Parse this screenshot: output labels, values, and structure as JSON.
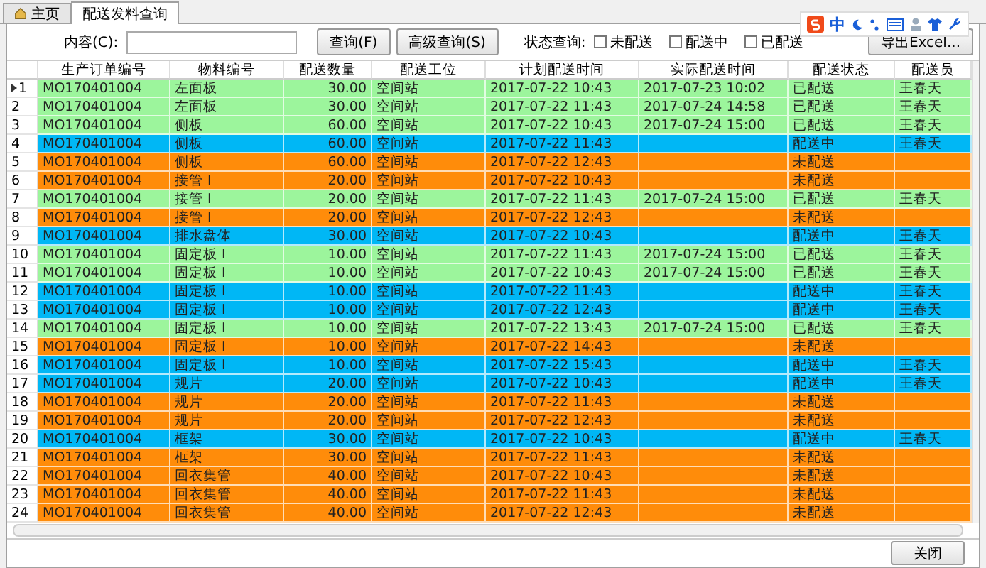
{
  "tabs": [
    {
      "label": "主页",
      "kind": "home",
      "selected": false
    },
    {
      "label": "配送发料查询",
      "kind": "plain",
      "selected": true
    }
  ],
  "ime_bar": {
    "label": "中"
  },
  "filter": {
    "content_label": "内容(C):",
    "query_button": "查询(F)",
    "advanced_button": "高级查询(S)",
    "status_label": "状态查询:",
    "statuses": [
      {
        "label": "未配送",
        "checked": false
      },
      {
        "label": "配送中",
        "checked": false
      },
      {
        "label": "已配送",
        "checked": false
      }
    ],
    "export_button": "导出Excel..."
  },
  "table": {
    "columns": [
      "生产订单编号",
      "物料编号",
      "配送数量",
      "配送工位",
      "计划配送时间",
      "实际配送时间",
      "配送状态",
      "配送员"
    ],
    "rows": [
      {
        "num": "1",
        "selected": true,
        "color": "#9cf59c",
        "cells": [
          "MO170401004",
          "左面板",
          "30.00",
          "空间站",
          "2017-07-22 10:43",
          "2017-07-23 10:02",
          "已配送",
          "王春天"
        ]
      },
      {
        "num": "2",
        "selected": false,
        "color": "#9cf59c",
        "cells": [
          "MO170401004",
          "左面板",
          "30.00",
          "空间站",
          "2017-07-22 11:43",
          "2017-07-24 14:58",
          "已配送",
          "王春天"
        ]
      },
      {
        "num": "3",
        "selected": false,
        "color": "#9cf59c",
        "cells": [
          "MO170401004",
          "侧板",
          "60.00",
          "空间站",
          "2017-07-22 10:43",
          "2017-07-24 15:00",
          "已配送",
          "王春天"
        ]
      },
      {
        "num": "4",
        "selected": false,
        "color": "#00b7f5",
        "cells": [
          "MO170401004",
          "侧板",
          "60.00",
          "空间站",
          "2017-07-22 11:43",
          "",
          "配送中",
          "王春天"
        ]
      },
      {
        "num": "5",
        "selected": false,
        "color": "#ff8c0a",
        "cells": [
          "MO170401004",
          "侧板",
          "60.00",
          "空间站",
          "2017-07-22 12:43",
          "",
          "未配送",
          ""
        ]
      },
      {
        "num": "6",
        "selected": false,
        "color": "#ff8c0a",
        "cells": [
          "MO170401004",
          "接管 I",
          "20.00",
          "空间站",
          "2017-07-22 10:43",
          "",
          "未配送",
          ""
        ]
      },
      {
        "num": "7",
        "selected": false,
        "color": "#9cf59c",
        "cells": [
          "MO170401004",
          "接管 I",
          "20.00",
          "空间站",
          "2017-07-22 11:43",
          "2017-07-24 15:00",
          "已配送",
          "王春天"
        ]
      },
      {
        "num": "8",
        "selected": false,
        "color": "#ff8c0a",
        "cells": [
          "MO170401004",
          "接管 I",
          "20.00",
          "空间站",
          "2017-07-22 12:43",
          "",
          "未配送",
          ""
        ]
      },
      {
        "num": "9",
        "selected": false,
        "color": "#00b7f5",
        "cells": [
          "MO170401004",
          "排水盘体",
          "30.00",
          "空间站",
          "2017-07-22 10:43",
          "",
          "配送中",
          "王春天"
        ]
      },
      {
        "num": "10",
        "selected": false,
        "color": "#9cf59c",
        "cells": [
          "MO170401004",
          "固定板 I",
          "10.00",
          "空间站",
          "2017-07-22 11:43",
          "2017-07-24 15:00",
          "已配送",
          "王春天"
        ]
      },
      {
        "num": "11",
        "selected": false,
        "color": "#9cf59c",
        "cells": [
          "MO170401004",
          "固定板 I",
          "10.00",
          "空间站",
          "2017-07-22 10:43",
          "2017-07-24 15:00",
          "已配送",
          "王春天"
        ]
      },
      {
        "num": "12",
        "selected": false,
        "color": "#00b7f5",
        "cells": [
          "MO170401004",
          "固定板 I",
          "10.00",
          "空间站",
          "2017-07-22 11:43",
          "",
          "配送中",
          "王春天"
        ]
      },
      {
        "num": "13",
        "selected": false,
        "color": "#00b7f5",
        "cells": [
          "MO170401004",
          "固定板 I",
          "10.00",
          "空间站",
          "2017-07-22 12:43",
          "",
          "配送中",
          "王春天"
        ]
      },
      {
        "num": "14",
        "selected": false,
        "color": "#9cf59c",
        "cells": [
          "MO170401004",
          "固定板 I",
          "10.00",
          "空间站",
          "2017-07-22 13:43",
          "2017-07-24 15:00",
          "已配送",
          "王春天"
        ]
      },
      {
        "num": "15",
        "selected": false,
        "color": "#ff8c0a",
        "cells": [
          "MO170401004",
          "固定板 I",
          "10.00",
          "空间站",
          "2017-07-22 14:43",
          "",
          "未配送",
          ""
        ]
      },
      {
        "num": "16",
        "selected": false,
        "color": "#00b7f5",
        "cells": [
          "MO170401004",
          "固定板 I",
          "10.00",
          "空间站",
          "2017-07-22 15:43",
          "",
          "配送中",
          "王春天"
        ]
      },
      {
        "num": "17",
        "selected": false,
        "color": "#00b7f5",
        "cells": [
          "MO170401004",
          "规片",
          "20.00",
          "空间站",
          "2017-07-22 10:43",
          "",
          "配送中",
          "王春天"
        ]
      },
      {
        "num": "18",
        "selected": false,
        "color": "#ff8c0a",
        "cells": [
          "MO170401004",
          "规片",
          "20.00",
          "空间站",
          "2017-07-22 11:43",
          "",
          "未配送",
          ""
        ]
      },
      {
        "num": "19",
        "selected": false,
        "color": "#ff8c0a",
        "cells": [
          "MO170401004",
          "规片",
          "20.00",
          "空间站",
          "2017-07-22 12:43",
          "",
          "未配送",
          ""
        ]
      },
      {
        "num": "20",
        "selected": false,
        "color": "#00b7f5",
        "cells": [
          "MO170401004",
          "框架",
          "30.00",
          "空间站",
          "2017-07-22 10:43",
          "",
          "配送中",
          "王春天"
        ]
      },
      {
        "num": "21",
        "selected": false,
        "color": "#ff8c0a",
        "cells": [
          "MO170401004",
          "框架",
          "30.00",
          "空间站",
          "2017-07-22 11:43",
          "",
          "未配送",
          ""
        ]
      },
      {
        "num": "22",
        "selected": false,
        "color": "#ff8c0a",
        "cells": [
          "MO170401004",
          "回衣集管",
          "40.00",
          "空间站",
          "2017-07-22 10:43",
          "",
          "未配送",
          ""
        ]
      },
      {
        "num": "23",
        "selected": false,
        "color": "#ff8c0a",
        "cells": [
          "MO170401004",
          "回衣集管",
          "40.00",
          "空间站",
          "2017-07-22 11:43",
          "",
          "未配送",
          ""
        ]
      },
      {
        "num": "24",
        "selected": false,
        "color": "#ff8c0a",
        "cells": [
          "MO170401004",
          "回衣集管",
          "40.00",
          "空间站",
          "2017-07-22 12:43",
          "",
          "未配送",
          ""
        ]
      }
    ]
  },
  "close_button": "关闭"
}
